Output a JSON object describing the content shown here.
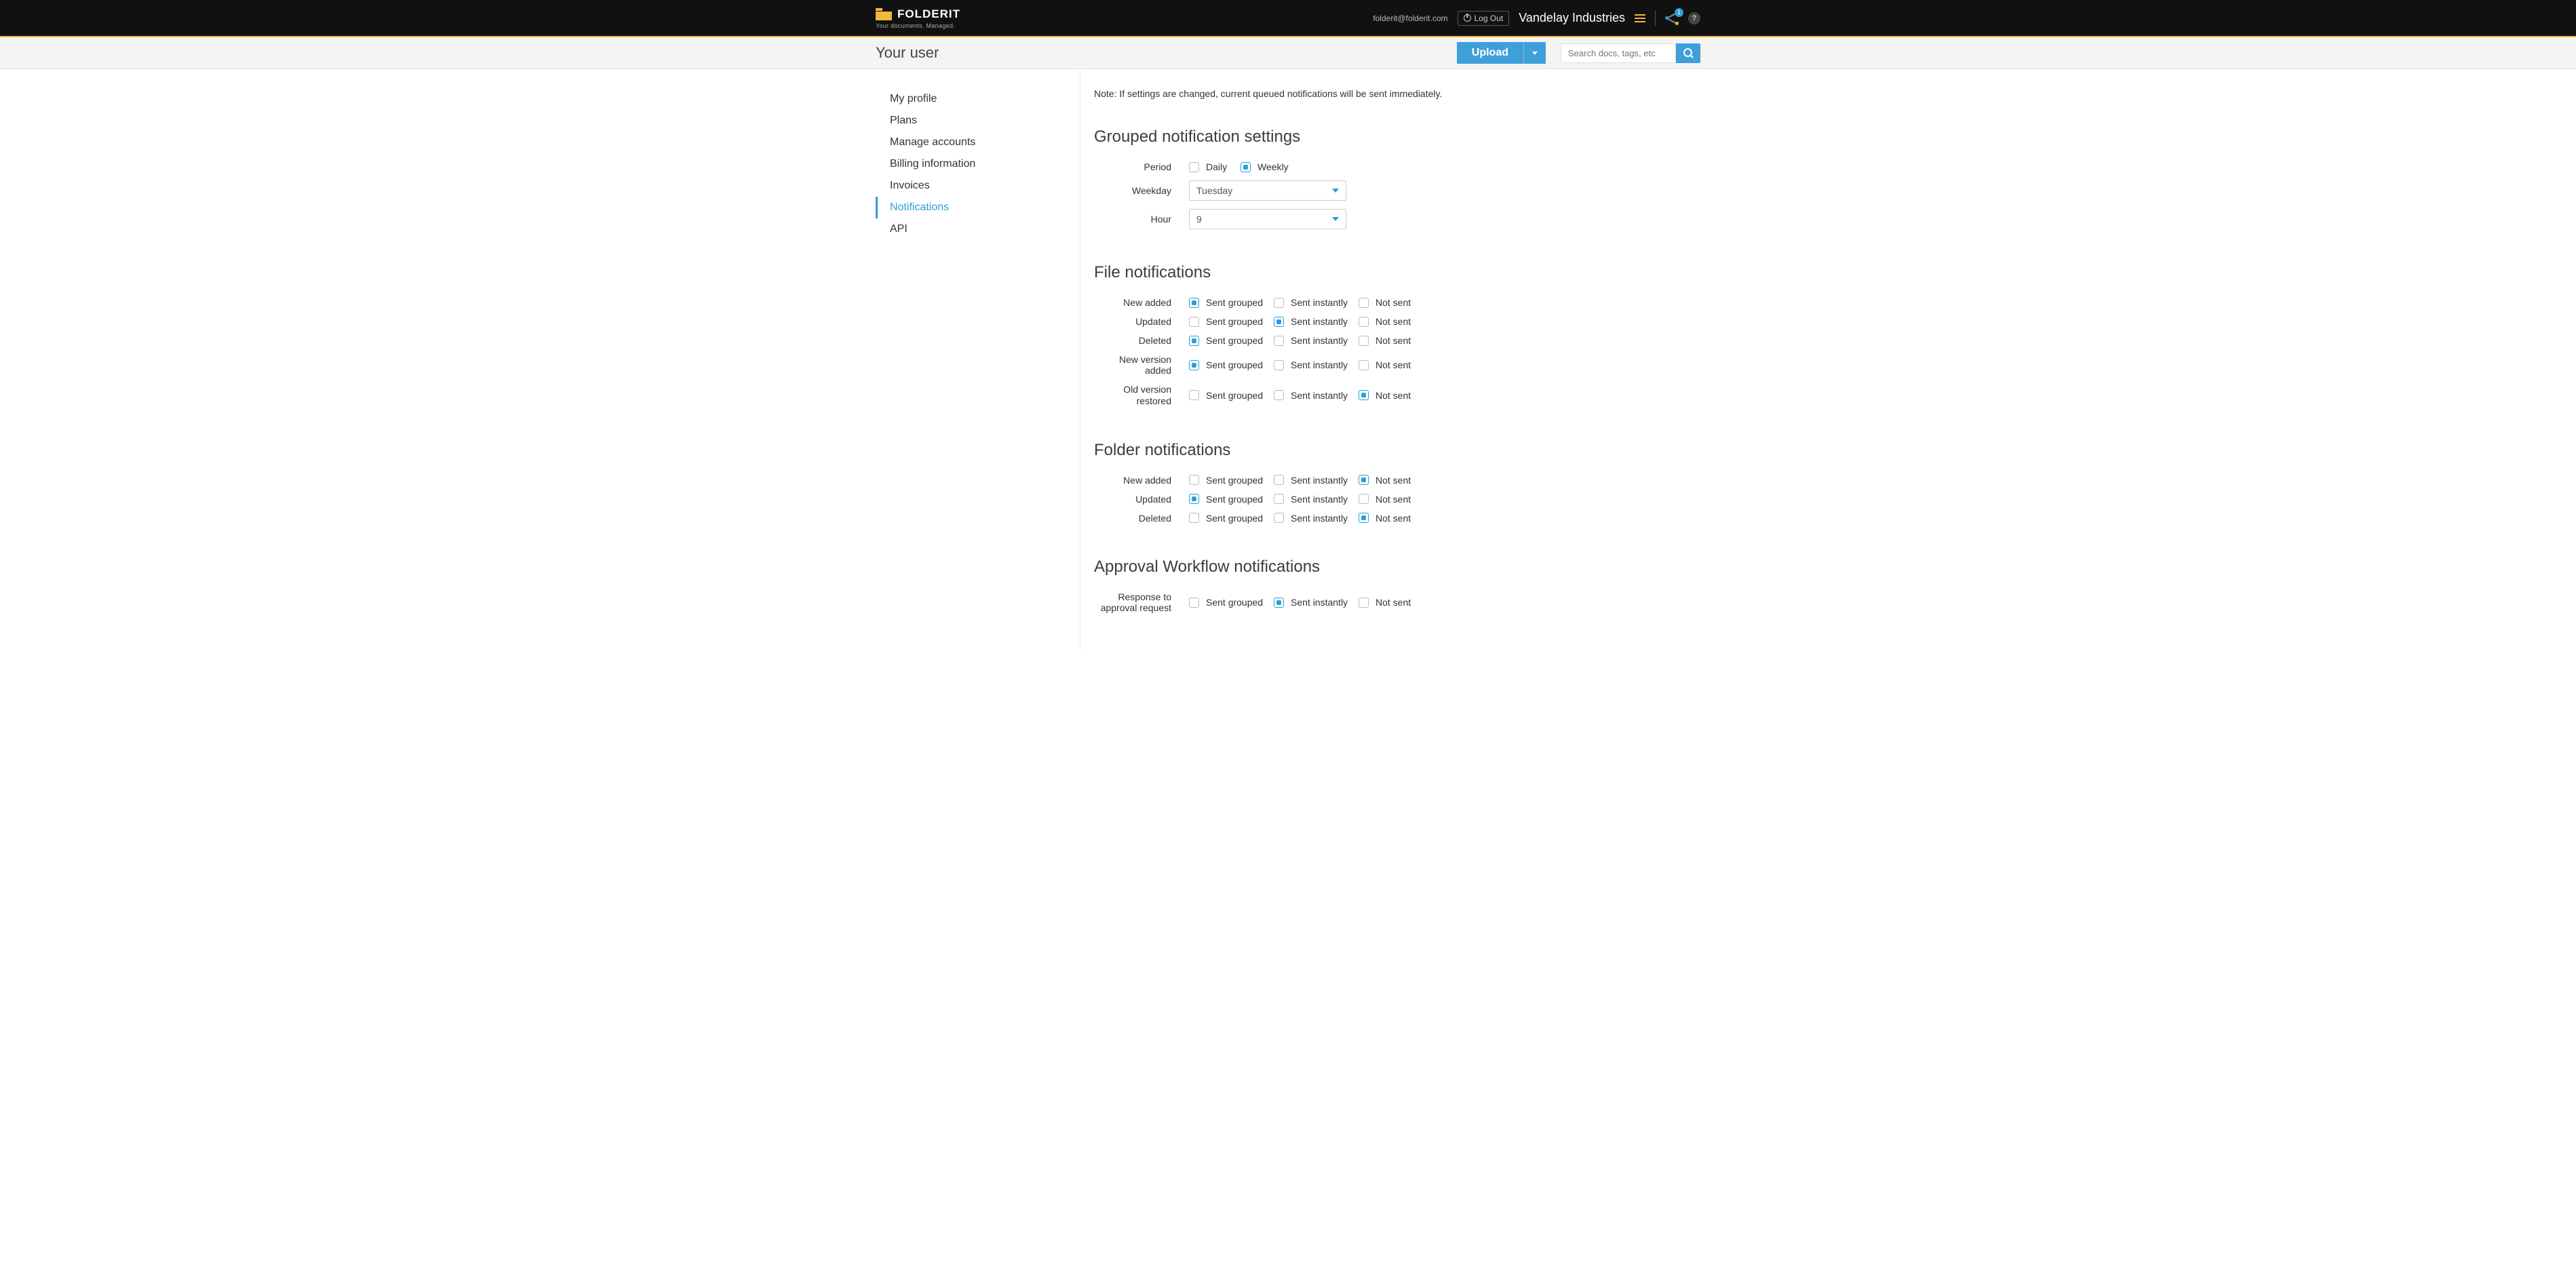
{
  "header": {
    "brand": "FOLDERIT",
    "tagline": "Your documents. Managed.",
    "email": "folderit@folderit.com",
    "logout": "Log Out",
    "org": "Vandelay Industries",
    "share_badge": "1",
    "help": "?"
  },
  "subheader": {
    "title": "Your user",
    "upload": "Upload",
    "search_placeholder": "Search docs, tags, etc"
  },
  "sidebar": {
    "items": [
      {
        "label": "My profile"
      },
      {
        "label": "Plans"
      },
      {
        "label": "Manage accounts"
      },
      {
        "label": "Billing information"
      },
      {
        "label": "Invoices"
      },
      {
        "label": "Notifications"
      },
      {
        "label": "API"
      }
    ],
    "active_index": 5
  },
  "content": {
    "note": "Note: If settings are changed, current queued notifications will be sent immediately.",
    "grouped": {
      "title": "Grouped notification settings",
      "period_label": "Period",
      "daily": "Daily",
      "weekly": "Weekly",
      "period_selected": "weekly",
      "weekday_label": "Weekday",
      "weekday_value": "Tuesday",
      "hour_label": "Hour",
      "hour_value": "9"
    },
    "radio_options": {
      "grouped": "Sent grouped",
      "instant": "Sent instantly",
      "notsent": "Not sent"
    },
    "file": {
      "title": "File notifications",
      "rows": [
        {
          "label": "New added",
          "selected": "grouped"
        },
        {
          "label": "Updated",
          "selected": "instant"
        },
        {
          "label": "Deleted",
          "selected": "grouped"
        },
        {
          "label": "New version added",
          "selected": "grouped"
        },
        {
          "label": "Old version restored",
          "selected": "notsent"
        }
      ]
    },
    "folder": {
      "title": "Folder notifications",
      "rows": [
        {
          "label": "New added",
          "selected": "notsent"
        },
        {
          "label": "Updated",
          "selected": "grouped"
        },
        {
          "label": "Deleted",
          "selected": "notsent"
        }
      ]
    },
    "approval": {
      "title": "Approval Workflow notifications",
      "rows": [
        {
          "label": "Response to approval request",
          "selected": "instant"
        }
      ]
    }
  }
}
